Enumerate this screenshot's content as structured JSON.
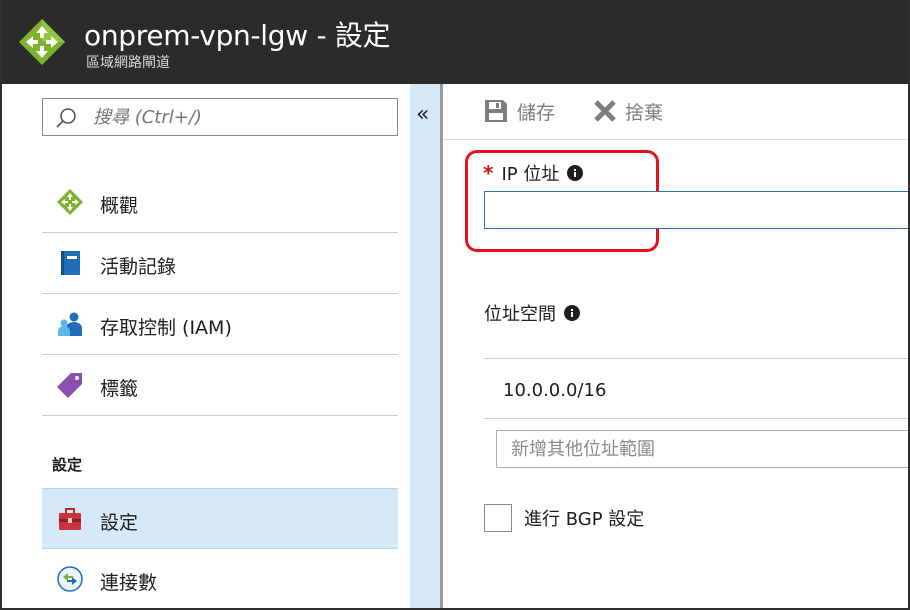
{
  "header": {
    "title": "onprem-vpn-lgw - 設定",
    "subtitle": "區域網路閘道"
  },
  "search": {
    "placeholder": "搜尋 (Ctrl+/)"
  },
  "menu": {
    "items": [
      {
        "label": "概觀",
        "icon": "gateway-icon"
      },
      {
        "label": "活動記錄",
        "icon": "activity-log-icon"
      },
      {
        "label": "存取控制 (IAM)",
        "icon": "iam-icon"
      },
      {
        "label": "標籤",
        "icon": "tag-icon"
      }
    ],
    "section_label": "設定",
    "settings_items": [
      {
        "label": "設定",
        "icon": "settings-toolbox-icon",
        "selected": true
      },
      {
        "label": "連接數",
        "icon": "connections-icon",
        "selected": false
      }
    ]
  },
  "collapse": {
    "glyph": "«"
  },
  "toolbar": {
    "save_label": "儲存",
    "discard_label": "捨棄"
  },
  "form": {
    "ip_label": "IP 位址",
    "ip_required_mark": "*",
    "ip_value": "",
    "address_space_label": "位址空間",
    "address_space_values": [
      "10.0.0.0/16"
    ],
    "add_address_placeholder": "新增其他位址範圍",
    "bgp_label": "進行 BGP 設定",
    "bgp_checked": false
  },
  "colors": {
    "header_bg": "#2b2b2b",
    "selected_bg": "#d6e9f8",
    "highlight_red": "#e8101a",
    "input_border_blue": "#2d6fb7"
  }
}
